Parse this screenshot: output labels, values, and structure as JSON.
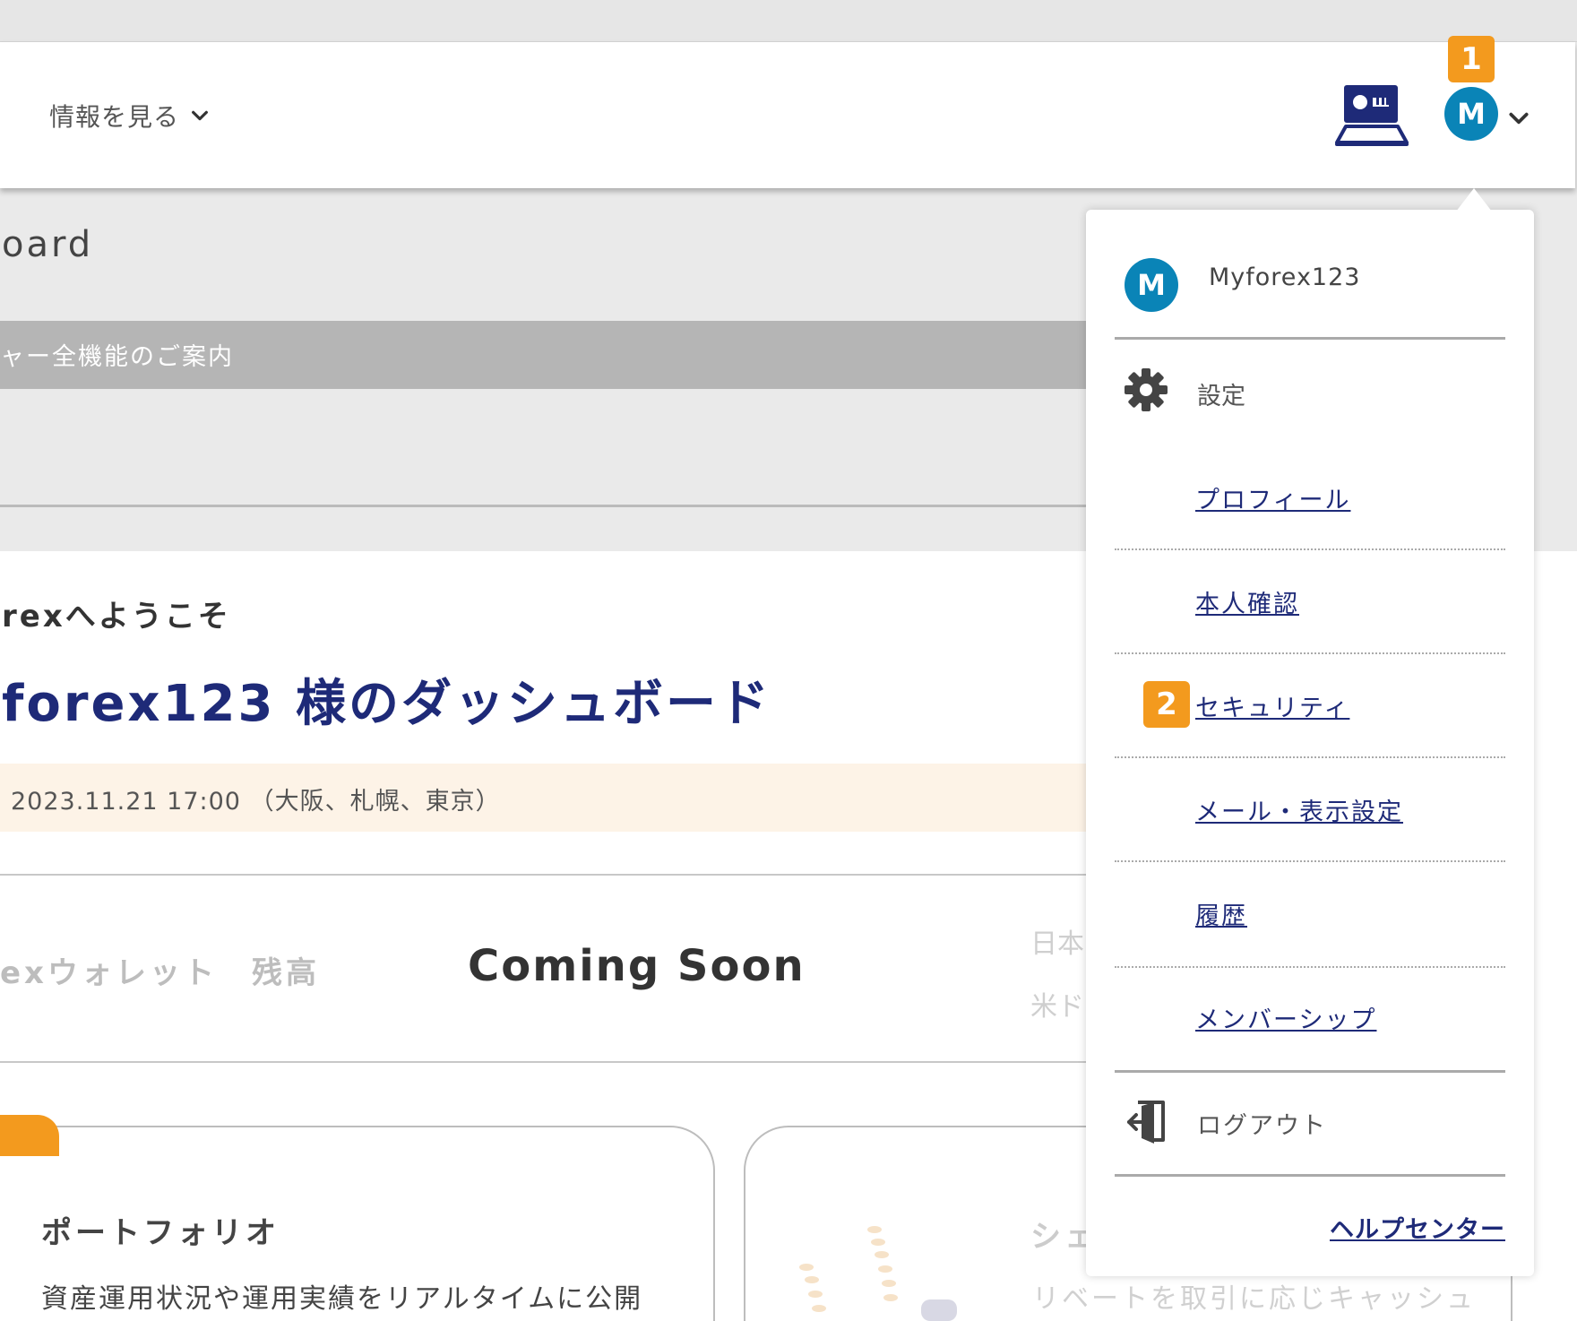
{
  "header": {
    "nav_info_label": "情報を見る",
    "badge_1": "1",
    "avatar_initial": "M"
  },
  "page": {
    "dashboard_title": "oard",
    "guide_banner": "ャー全機能のご案内",
    "welcome": "rexへようこそ",
    "dashboard_heading": "forex123 様のダッシュボード",
    "datetime": "2023.11.21 17:00 （大阪、札幌、東京）",
    "wallet_label": "exウォレット　残高",
    "coming_soon": "Coming Soon",
    "currency_jp": "日本",
    "currency_us": "米ド",
    "portfolio_title": "ポートフォリオ",
    "portfolio_desc": "資産運用状況や運用実績をリアルタイムに公開",
    "share_title": "シェ",
    "share_desc": "リベートを取引に応じキャッシュ"
  },
  "dropdown": {
    "avatar_initial": "M",
    "username": "Myforex123",
    "settings_label": "設定",
    "items": [
      {
        "label": "プロフィール"
      },
      {
        "label": "本人確認"
      },
      {
        "label": "セキュリティ"
      },
      {
        "label": "メール・表示設定"
      },
      {
        "label": "履歴"
      },
      {
        "label": "メンバーシップ"
      }
    ],
    "badge_2": "2",
    "logout_label": "ログアウト",
    "help_center": "ヘルプセンター"
  },
  "icons": {
    "monitor": "monitor-chart-icon",
    "settings": "gear-icon",
    "logout": "logout-door-icon",
    "chevron": "chevron-down-icon"
  },
  "colors": {
    "brand_navy": "#1e2a78",
    "avatar_blue": "#0a84b7",
    "badge_orange": "#f39a1e"
  }
}
